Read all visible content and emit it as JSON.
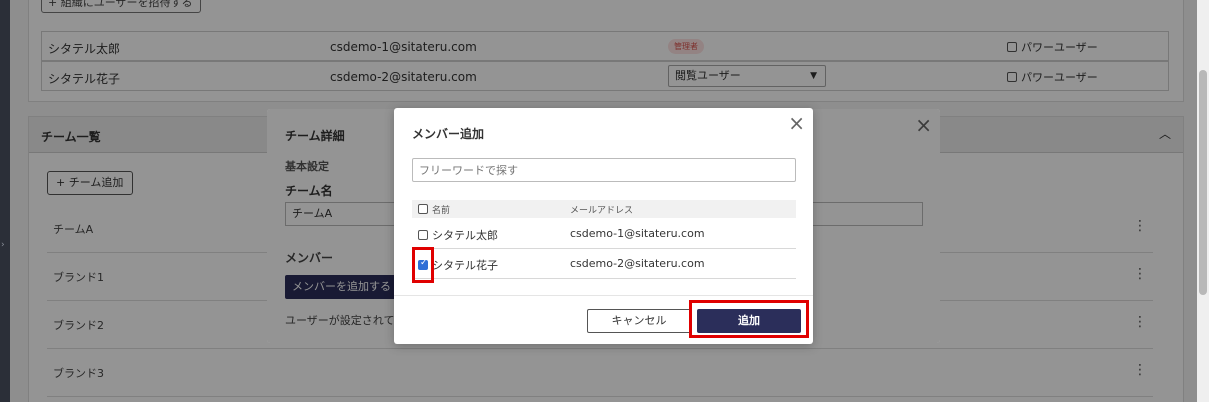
{
  "users_card": {
    "invite_label": "+ 組織にユーザーを招待する",
    "rows": [
      {
        "name": "シタテル太郎",
        "email": "csdemo-1@sitateru.com",
        "role_badge": "管理者",
        "power_user": "パワーユーザー"
      },
      {
        "name": "シタテル花子",
        "email": "csdemo-2@sitateru.com",
        "role_select": "閲覧ユーザー",
        "power_user": "パワーユーザー"
      }
    ]
  },
  "teams_card": {
    "title": "チーム一覧",
    "add_team_label": "+ チーム追加",
    "teams": [
      "チームA",
      "ブランド1",
      "ブランド2",
      "ブランド3"
    ]
  },
  "team_modal": {
    "title": "チーム詳細",
    "basic_settings": "基本設定",
    "team_name_label": "チーム名",
    "team_name_value": "チームA",
    "members_label": "メンバー",
    "add_member_label": "メンバーを追加する",
    "no_users_text": "ユーザーが設定されてい"
  },
  "member_modal": {
    "title": "メンバー追加",
    "search_placeholder": "フリーワードで探す",
    "col_name": "名前",
    "col_email": "メールアドレス",
    "rows": [
      {
        "name": "シタテル太郎",
        "email": "csdemo-1@sitateru.com",
        "checked": false
      },
      {
        "name": "シタテル花子",
        "email": "csdemo-2@sitateru.com",
        "checked": true
      }
    ],
    "cancel_label": "キャンセル",
    "add_label": "追加"
  },
  "colors": {
    "primary": "#2b2e5a",
    "highlight": "#e00000",
    "check": "#2f6fd6"
  }
}
